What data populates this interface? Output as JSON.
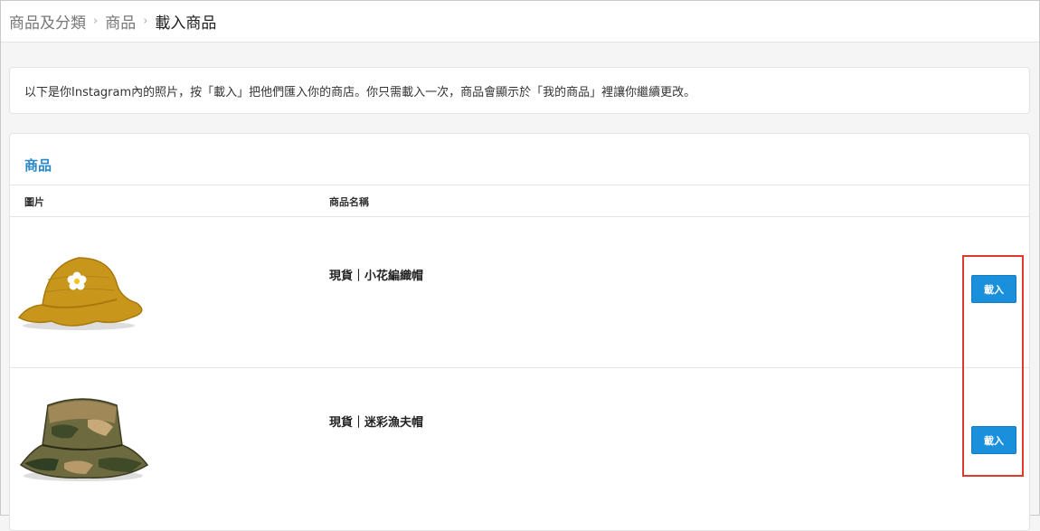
{
  "breadcrumb": {
    "items": [
      "商品及分類",
      "商品"
    ],
    "separator": "›",
    "current": "載入商品"
  },
  "notice": {
    "text": "以下是你Instagram內的照片，按「載入」把他們匯入你的商店。你只需載入一次，商品會顯示於「我的商品」裡讓你繼續更改。"
  },
  "products_panel": {
    "title": "商品",
    "columns": {
      "image": "圖片",
      "name": "商品名稱"
    },
    "rows": [
      {
        "name": "現貨｜小花編織帽",
        "image_icon": "crochet-hat-icon",
        "action_label": "載入"
      },
      {
        "name": "現貨｜迷彩漁夫帽",
        "image_icon": "camo-bucket-hat-icon",
        "action_label": "載入"
      }
    ]
  },
  "colors": {
    "accent": "#2a88c8",
    "button": "#1a8fdc",
    "highlight": "#e0392b"
  }
}
